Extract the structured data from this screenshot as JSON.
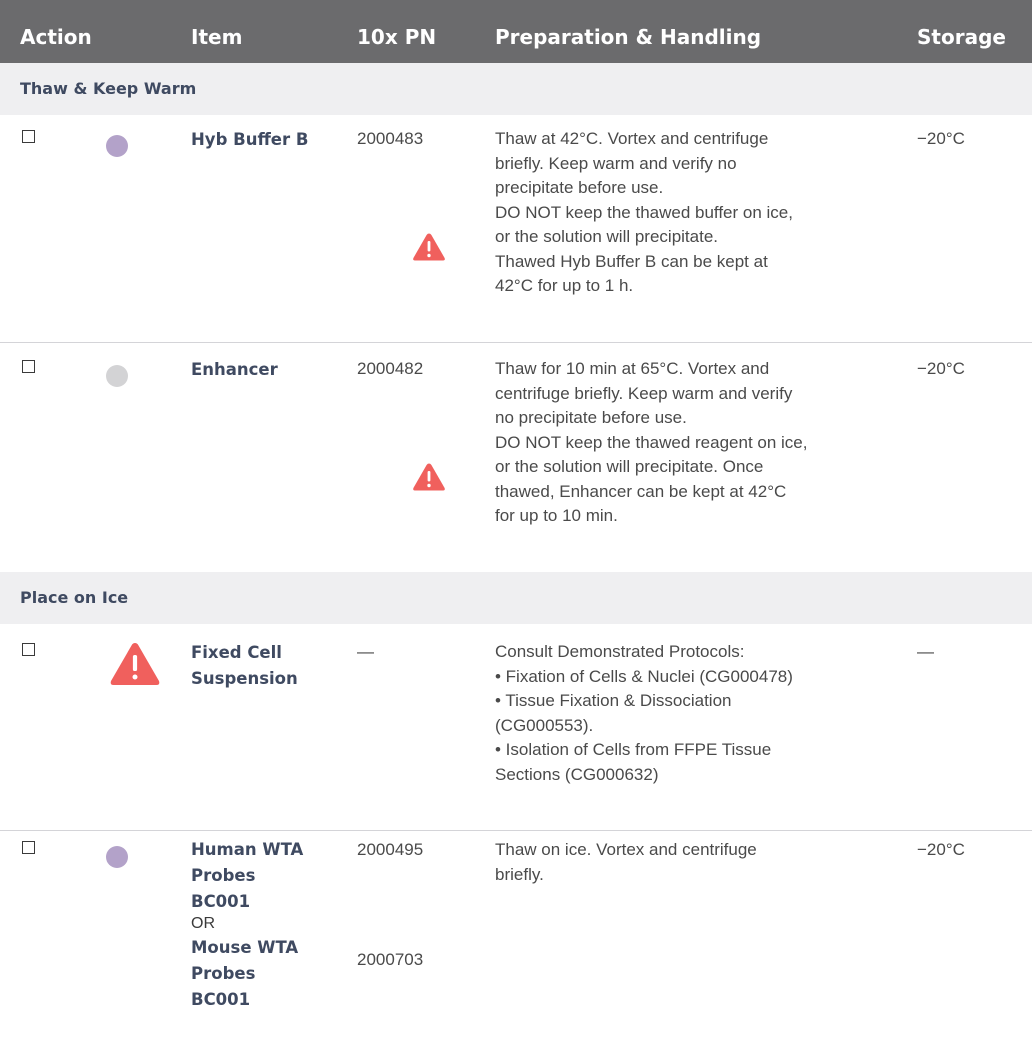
{
  "header": {
    "action": "Action",
    "item": "Item",
    "pn": "10x PN",
    "prep": "Preparation & Handling",
    "storage": "Storage"
  },
  "sections": [
    {
      "title": "Thaw & Keep Warm",
      "rows": [
        {
          "item": "Hyb Buffer B",
          "dot_color": "#b3a2c9",
          "pn": "2000483",
          "prep": [
            "Thaw at 42°C. Vortex and centrifuge",
            "briefly. Keep warm and verify no",
            "precipitate before use.",
            "DO NOT keep the thawed buffer on ice,",
            "or the solution will precipitate.",
            "Thawed Hyb Buffer B can be kept at",
            "42°C for up to 1 h."
          ],
          "storage": "−20°C",
          "warning_icon": "warning-triangle-icon"
        },
        {
          "item": "Enhancer",
          "dot_color": "#d3d3d5",
          "pn": "2000482",
          "prep": [
            "Thaw for 10 min at 65°C. Vortex and",
            "centrifuge briefly. Keep warm and verify",
            "no precipitate before use.",
            "DO NOT keep the thawed reagent on ice,",
            "or the solution will precipitate. Once",
            "thawed, Enhancer can be kept at 42°C",
            "for up to 10 min."
          ],
          "storage": "−20°C",
          "warning_icon": "warning-triangle-icon"
        }
      ]
    },
    {
      "title": "Place on Ice",
      "rows": [
        {
          "item_lines": [
            "Fixed Cell",
            "Suspension"
          ],
          "pn": "—",
          "prep": [
            "Consult Demonstrated Protocols:",
            "• Fixation of Cells & Nuclei (CG000478)",
            "• Tissue Fixation & Dissociation",
            "(CG000553).",
            "• Isolation of Cells from FFPE Tissue",
            "Sections (CG000632)"
          ],
          "storage": "—",
          "warning_icon": "warning-triangle-icon"
        },
        {
          "item_a_lines": [
            "Human WTA",
            "Probes",
            "BC001"
          ],
          "or": "OR",
          "item_b_lines": [
            "Mouse WTA",
            "Probes",
            "BC001"
          ],
          "dot_color": "#b3a2c9",
          "pn_a": "2000495",
          "pn_b": "2000703",
          "prep": [
            "Thaw on ice. Vortex and centrifuge",
            "briefly."
          ],
          "storage": "−20°C"
        }
      ]
    }
  ],
  "colors": {
    "header_bg": "#6b6b6d",
    "section_bg": "#efeff1",
    "item_text": "#3f4a61",
    "warning": "#f0605d"
  }
}
